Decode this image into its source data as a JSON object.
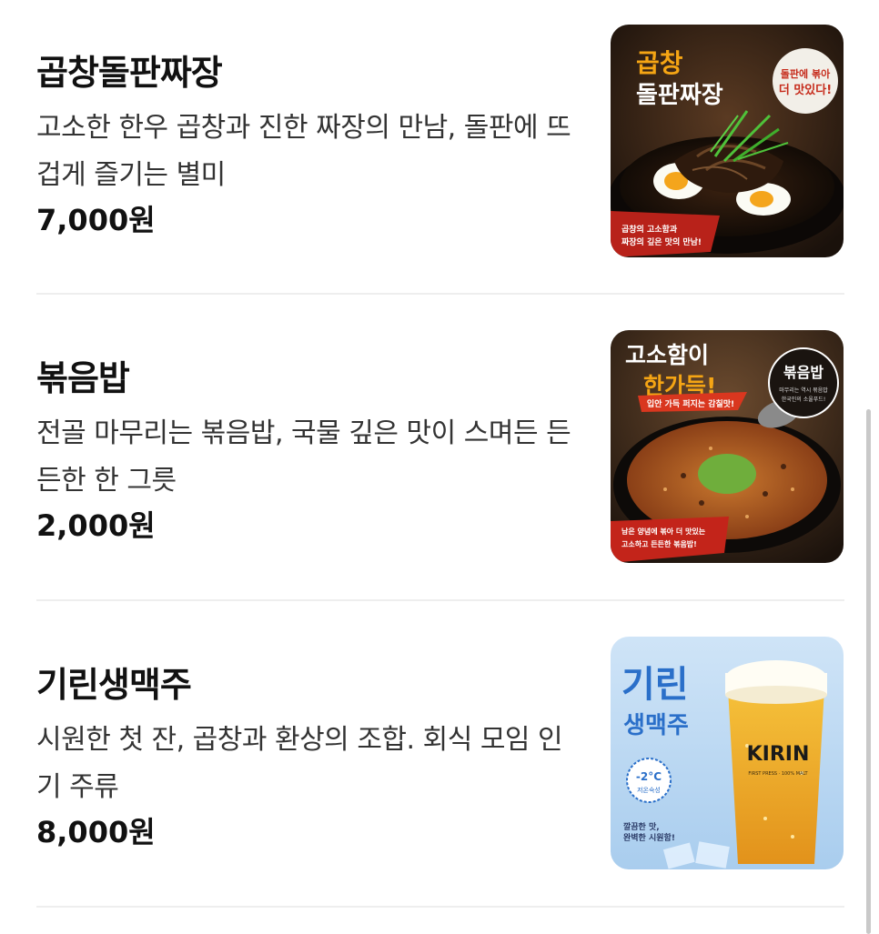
{
  "menu": {
    "items": [
      {
        "name": "곱창돌판짜장",
        "description": "고소한 한우 곱창과 진한 짜장의 만남, 돌판에 뜨겁게 즐기는 별미",
        "price": "7,000원",
        "image": {
          "title_line1": "곱창",
          "title_line2": "돌판짜장",
          "badge_line1": "돌판에 볶아",
          "badge_line2": "더 맛있다!",
          "caption_line1": "곱창의 고소함과",
          "caption_line2": "짜장의 깊은 맛의 만남!"
        }
      },
      {
        "name": "볶음밥",
        "description": "전골 마무리는 볶음밥, 국물 깊은 맛이 스며든 든든한 한 그릇",
        "price": "2,000원",
        "image": {
          "title_line1": "고소함이",
          "title_line2": "한가득!",
          "badge": "볶음밥",
          "badge_sub1": "마무리는 역시 볶음밥",
          "badge_sub2": "한국인의 소울푸드!",
          "ribbon": "입안 가득 퍼지는 감칠맛!",
          "caption_line1": "남은 양념에 볶아 더 맛있는",
          "caption_line2": "고소하고 든든한 볶음밥!"
        }
      },
      {
        "name": "기린생맥주",
        "description": "시원한 첫 잔, 곱창과 환상의 조합. 회식 모임 인기 주류",
        "price": "8,000원",
        "image": {
          "title_line1": "기린",
          "title_line2": "생맥주",
          "temp": "-2°C",
          "temp_label": "저온숙성",
          "brand": "KIRIN",
          "glass_sub": "FIRST PRESS · 100% MALT",
          "caption_line1": "깔끔한 맛,",
          "caption_line2": "완벽한 시원함!"
        }
      }
    ]
  }
}
